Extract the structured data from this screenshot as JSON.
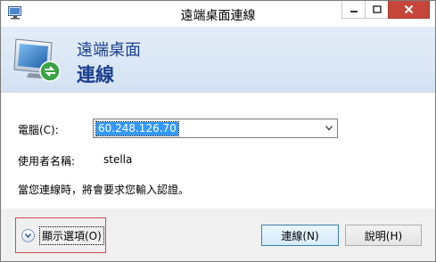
{
  "window": {
    "title": "遠端桌面連線",
    "icon": "remote-desktop-icon",
    "controls": [
      "minimize-icon",
      "maximize-icon",
      "close-icon"
    ]
  },
  "header": {
    "line1": "遠端桌面",
    "line2": "連線",
    "art": "remote-desktop-monitor-icon"
  },
  "form": {
    "computer_label": "電腦(C):",
    "computer_value": "60.248.126.70",
    "username_label": "使用者名稱:",
    "username_value": "stella",
    "info_text": "當您連線時，將會要求您輸入認證。"
  },
  "footer": {
    "show_options_label": "顯示選項(O)",
    "connect_label": "連線(N)",
    "help_label": "說明(H)"
  },
  "colors": {
    "header_text": "#1b3f8f",
    "close_button": "#c7463c",
    "selection": "#3399ff",
    "highlight_border": "#d24a4a"
  }
}
